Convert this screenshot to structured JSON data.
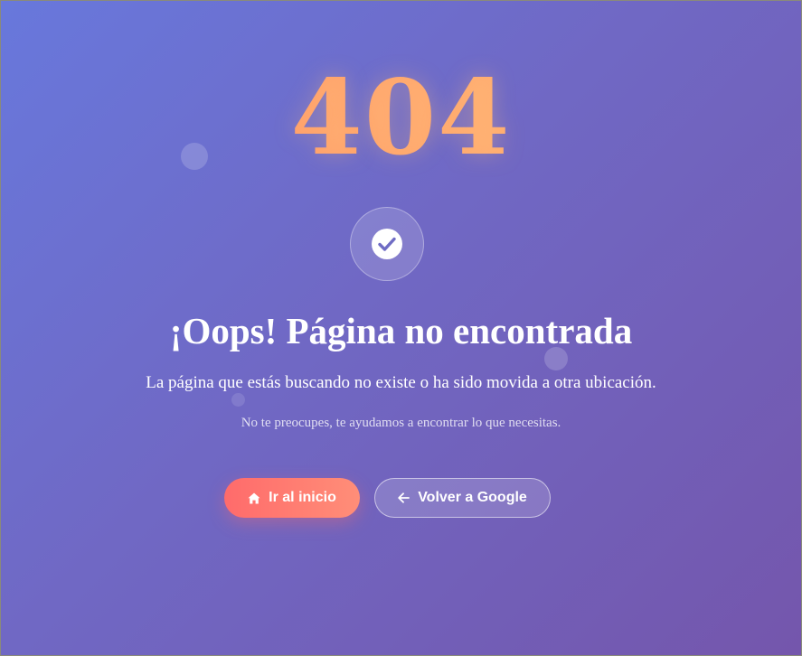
{
  "error_code": "404",
  "badge_icon": "check-circle-icon",
  "title": "¡Oops! Página no encontrada",
  "subtitle": "La página que estás buscando no existe o ha sido movida a otra ubicación.",
  "hint": "No te preocupes, te ayudamos a encontrar lo que necesitas.",
  "buttons": {
    "home": {
      "label": "Ir al inicio",
      "icon": "home-icon"
    },
    "back": {
      "label": "Volver a Google",
      "icon": "arrow-left-icon"
    }
  },
  "colors": {
    "background_start": "#6878dc",
    "background_end": "#7456ac",
    "error_code_start": "#ff8f63",
    "error_code_end": "#ffc07a",
    "primary_button": "#ff6b6b",
    "text": "#ffffff"
  }
}
